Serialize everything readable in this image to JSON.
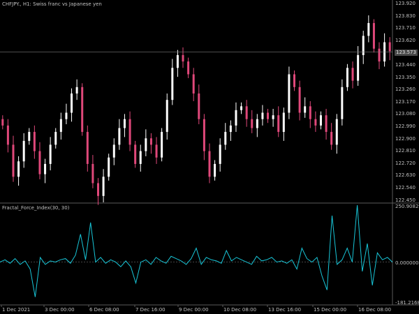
{
  "chart_title": "CHFJPY., H1:  Swiss franc vs Japanese yen",
  "indicator_title": "Fractal_Force_Index(30, 30)",
  "colors": {
    "background": "#000000",
    "bull_candle": "#ffffff",
    "bear_candle": "#e0487a",
    "indicator_line": "#18c6d8",
    "grid_line": "#5a5a5a",
    "price_line": "#7a7a7a",
    "axis_text": "#c0c0c0"
  },
  "price_axis": {
    "labels": [
      "123.920",
      "123.830",
      "123.710",
      "123.620",
      "123.530",
      "123.440",
      "123.350",
      "123.260",
      "123.170",
      "123.080",
      "122.990",
      "122.900",
      "122.810",
      "122.720",
      "122.630",
      "122.540",
      "122.450"
    ],
    "current_price": "123.573"
  },
  "indicator_axis": {
    "top_label": "250.908293",
    "zero_label": "0.000000",
    "bottom_label": "-181.21689"
  },
  "time_axis": {
    "labels": [
      "1 Dec 2021",
      "3 Dec 00:00",
      "6 Dec 08:00",
      "7 Dec 16:00",
      "9 Dec 00:00",
      "10 Dec 08:00",
      "13 Dec 16:00",
      "15 Dec 00:00",
      "16 Dec 08:00"
    ]
  },
  "chart_data": [
    {
      "type": "candlestick",
      "title": "CHFJPY., H1:  Swiss franc vs Japanese yen",
      "ylim": [
        122.4,
        123.98
      ],
      "x": [
        "1 Dec 2021",
        "3 Dec 00:00",
        "6 Dec 08:00",
        "7 Dec 16:00",
        "9 Dec 00:00",
        "10 Dec 08:00",
        "13 Dec 16:00",
        "15 Dec 00:00",
        "16 Dec 08:00"
      ],
      "close": [
        123.0,
        122.85,
        122.6,
        122.72,
        122.88,
        122.95,
        122.8,
        122.62,
        122.7,
        122.85,
        122.95,
        123.05,
        123.1,
        123.25,
        123.3,
        122.95,
        122.7,
        122.55,
        122.45,
        122.6,
        122.75,
        122.85,
        122.98,
        123.05,
        122.85,
        122.7,
        122.8,
        122.9,
        122.85,
        122.75,
        122.95,
        123.2,
        123.45,
        123.55,
        123.5,
        123.4,
        123.25,
        123.05,
        122.8,
        122.6,
        122.7,
        122.85,
        122.95,
        123.0,
        123.12,
        123.15,
        123.05,
        122.98,
        123.05,
        123.1,
        123.05,
        123.08,
        122.95,
        123.1,
        123.4,
        123.3,
        123.1,
        123.15,
        123.05,
        123.0,
        123.08,
        122.95,
        122.85,
        123.05,
        123.3,
        123.45,
        123.35,
        123.55,
        123.7,
        123.8,
        123.6,
        123.5,
        123.65,
        123.58
      ]
    },
    {
      "type": "line",
      "title": "Fractal_Force_Index(30, 30)",
      "ylim": [
        -181.21689,
        250.908293
      ],
      "x": [
        "1 Dec 2021",
        "3 Dec 00:00",
        "6 Dec 08:00",
        "7 Dec 16:00",
        "9 Dec 00:00",
        "10 Dec 08:00",
        "13 Dec 16:00",
        "15 Dec 00:00",
        "16 Dec 08:00"
      ],
      "series": [
        {
          "values": [
            0,
            10,
            -5,
            15,
            -10,
            5,
            -30,
            -150,
            20,
            -10,
            5,
            0,
            10,
            15,
            -5,
            30,
            120,
            10,
            170,
            0,
            20,
            -5,
            10,
            0,
            -20,
            5,
            -20,
            -90,
            0,
            10,
            -10,
            20,
            5,
            -5,
            25,
            15,
            5,
            -10,
            15,
            60,
            -10,
            20,
            10,
            5,
            -5,
            50,
            5,
            20,
            10,
            0,
            -10,
            25,
            5,
            10,
            20,
            0,
            5,
            -5,
            10,
            -30,
            60,
            15,
            0,
            20,
            -60,
            -120,
            200,
            -10,
            10,
            60,
            0,
            245,
            -40,
            80,
            -100,
            40,
            10,
            20,
            0
          ]
        }
      ]
    }
  ]
}
